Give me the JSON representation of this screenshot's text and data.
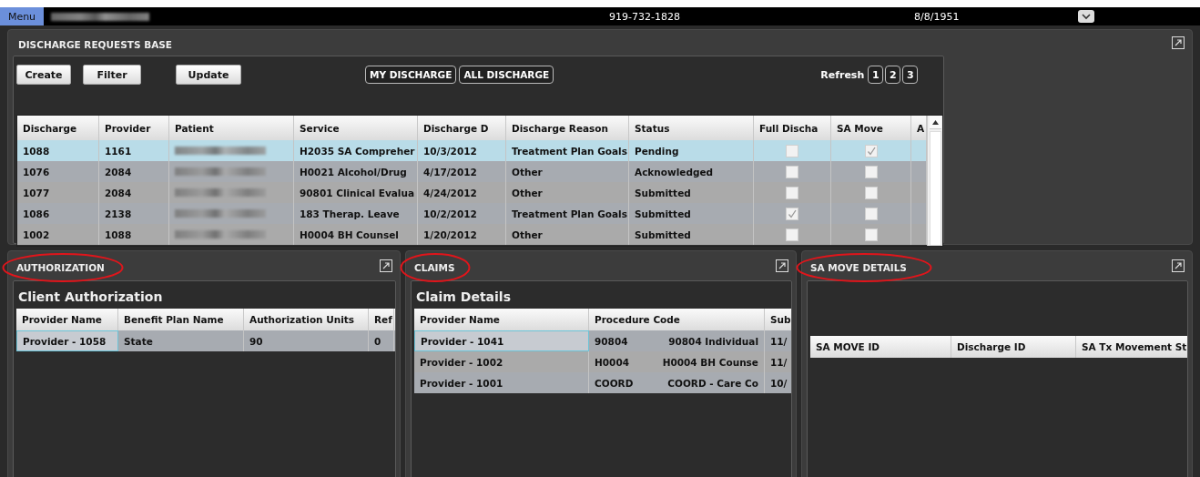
{
  "top_bar": {
    "menu_button": "Menu",
    "user_name": {
      "redacted": true
    },
    "phone": "919-732-1828",
    "birth_date": "8/8/1951"
  },
  "discharge_panel": {
    "title": "DISCHARGE REQUESTS BASE",
    "buttons": [
      "Create",
      "Filter",
      "Update"
    ],
    "view_toggles": [
      "MY DISCHARGE",
      "ALL DISCHARGE"
    ],
    "refresh_label": "Refresh",
    "refresh_buttons": [
      "1",
      "2",
      "3"
    ],
    "table": {
      "columns": [
        "Discharge",
        "Provider",
        "Patient",
        "Service",
        "Discharge D",
        "Discharge Reason",
        "Status",
        "Full Discha",
        "SA Move",
        "A"
      ],
      "rows": [
        {
          "selected": true,
          "discharge_id": "1088",
          "provider": "1161",
          "patient": {
            "redacted": true
          },
          "service": "H2035 SA Compreher",
          "discharge_date": "10/3/2012",
          "reason": "Treatment Plan Goals",
          "status": "Pending",
          "full_discharge": false,
          "sa_move": true
        },
        {
          "selected": false,
          "discharge_id": "1076",
          "provider": "2084",
          "patient": {
            "redacted": true
          },
          "service": "H0021 Alcohol/Drug",
          "discharge_date": "4/17/2012",
          "reason": "Other",
          "status": "Acknowledged",
          "full_discharge": false,
          "sa_move": false
        },
        {
          "selected": false,
          "discharge_id": "1077",
          "provider": "2084",
          "patient": {
            "redacted": true
          },
          "service": "90801 Clinical Evalua",
          "discharge_date": "4/24/2012",
          "reason": "Other",
          "status": "Submitted",
          "full_discharge": false,
          "sa_move": false
        },
        {
          "selected": false,
          "discharge_id": "1086",
          "provider": "2138",
          "patient": {
            "redacted": true
          },
          "service": "183 Therap. Leave",
          "discharge_date": "10/2/2012",
          "reason": "Treatment Plan Goals",
          "status": "Submitted",
          "full_discharge": true,
          "sa_move": false
        },
        {
          "selected": false,
          "discharge_id": "1002",
          "provider": "1088",
          "patient": {
            "redacted": true
          },
          "service": "H0004 BH Counsel",
          "discharge_date": "1/20/2012",
          "reason": "Other",
          "status": "Submitted",
          "full_discharge": false,
          "sa_move": false
        }
      ]
    }
  },
  "panels": [
    {
      "kind": "grid",
      "title": "AUTHORIZATION",
      "highlighted": true,
      "subtitle": "Client Authorization",
      "table": {
        "columns": [
          "Provider Name",
          "Benefit Plan Name",
          "Authorization Units",
          "Ref"
        ],
        "rows": [
          {
            "cells": [
              "Provider - 1058",
              "State",
              "90",
              "0"
            ]
          }
        ]
      }
    },
    {
      "kind": "grid",
      "title": "CLAIMS",
      "highlighted": true,
      "subtitle": "Claim Details",
      "table": {
        "columns": [
          "Provider Name",
          "Procedure Code",
          "Sub"
        ],
        "rows": [
          {
            "cells": [
              "Provider - 1041",
              [
                "90804",
                "90804 Individual"
              ],
              "11/"
            ]
          },
          {
            "cells": [
              "Provider - 1002",
              [
                "H0004",
                "H0004 BH Counse"
              ],
              "11/"
            ]
          },
          {
            "cells": [
              "Provider - 1001",
              [
                "COORD",
                "COORD - Care Co"
              ],
              "10/"
            ]
          }
        ]
      }
    },
    {
      "kind": "grid",
      "title": "SA MOVE DETAILS",
      "highlighted": true,
      "table": {
        "columns": [
          "SA MOVE ID",
          "Discharge ID",
          "SA Tx Movement St"
        ]
      }
    }
  ]
}
